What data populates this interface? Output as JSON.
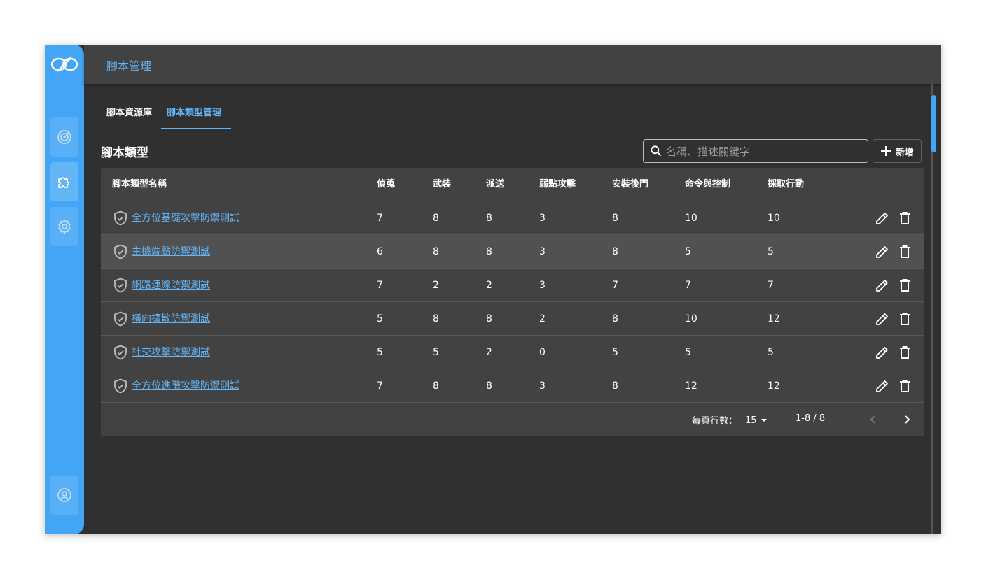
{
  "header": {
    "title": "腳本管理"
  },
  "sidebar": {
    "items": [
      {
        "icon": "radar-icon"
      },
      {
        "icon": "puzzle-icon"
      },
      {
        "icon": "gear-icon"
      }
    ],
    "bottom": {
      "icon": "account-icon"
    }
  },
  "tabs": [
    {
      "label": "腳本資源庫",
      "active": false
    },
    {
      "label": "腳本類型管理",
      "active": true
    }
  ],
  "section": {
    "title": "腳本類型"
  },
  "search": {
    "placeholder": "名稱、描述關鍵字"
  },
  "add_button": {
    "label": "新增"
  },
  "table": {
    "columns": [
      "腳本類型名稱",
      "偵蒐",
      "武裝",
      "派送",
      "弱點攻擊",
      "安裝後門",
      "命令與控制",
      "採取行動"
    ],
    "rows": [
      {
        "name": "全方位基礎攻擊防禦測試",
        "values": [
          "7",
          "8",
          "8",
          "3",
          "8",
          "10",
          "10"
        ]
      },
      {
        "name": "主機端點防禦測試",
        "values": [
          "6",
          "8",
          "8",
          "3",
          "8",
          "5",
          "5"
        ]
      },
      {
        "name": "網路連線防禦測試",
        "values": [
          "7",
          "2",
          "2",
          "3",
          "7",
          "7",
          "7"
        ]
      },
      {
        "name": "橫向擴散防禦測試",
        "values": [
          "5",
          "8",
          "8",
          "2",
          "8",
          "10",
          "12"
        ]
      },
      {
        "name": "社交攻擊防禦測試",
        "values": [
          "5",
          "5",
          "2",
          "0",
          "5",
          "5",
          "5"
        ]
      },
      {
        "name": "全方位進階攻擊防禦測試",
        "values": [
          "7",
          "8",
          "8",
          "3",
          "8",
          "12",
          "12"
        ]
      }
    ]
  },
  "pagination": {
    "rows_per_page_label": "每頁行數：",
    "rows_per_page": "15",
    "range": "1-8 / 8"
  },
  "colors": {
    "accent": "#42a5f5",
    "link": "#64b5f6",
    "background": "#303030",
    "surface": "#424242"
  }
}
